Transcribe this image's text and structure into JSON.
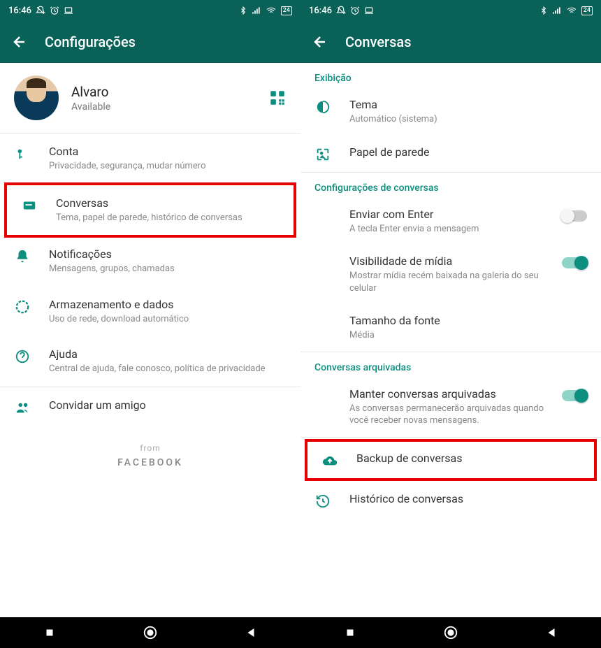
{
  "status": {
    "time": "16:46",
    "battery": "24"
  },
  "left": {
    "header_title": "Configurações",
    "profile": {
      "name": "Alvaro",
      "status": "Available"
    },
    "items": {
      "account": {
        "title": "Conta",
        "sub": "Privacidade, segurança, mudar número"
      },
      "chats": {
        "title": "Conversas",
        "sub": "Tema, papel de parede, histórico de conversas"
      },
      "notifications": {
        "title": "Notificações",
        "sub": "Mensagens, grupos, chamadas"
      },
      "storage": {
        "title": "Armazenamento e dados",
        "sub": "Uso de rede, download automático"
      },
      "help": {
        "title": "Ajuda",
        "sub": "Central de ajuda, fale conosco, política de privacidade"
      },
      "invite": {
        "title": "Convidar um amigo"
      }
    },
    "from_label": "from",
    "from_brand": "FACEBOOK"
  },
  "right": {
    "header_title": "Conversas",
    "sections": {
      "display": "Exibição",
      "chat_settings": "Configurações de conversas",
      "archived": "Conversas arquivadas"
    },
    "items": {
      "theme": {
        "title": "Tema",
        "sub": "Automático (sistema)"
      },
      "wallpaper": {
        "title": "Papel de parede"
      },
      "enter_send": {
        "title": "Enviar com Enter",
        "sub": "A tecla Enter envia a mensagem"
      },
      "media_visibility": {
        "title": "Visibilidade de mídia",
        "sub": "Mostrar mídia recém baixada na galeria do seu celular"
      },
      "font_size": {
        "title": "Tamanho da fonte",
        "sub": "Média"
      },
      "keep_archived": {
        "title": "Manter conversas arquivadas",
        "sub": "As conversas permanecerão arquivadas quando você receber novas mensagens."
      },
      "backup": {
        "title": "Backup de conversas"
      },
      "history": {
        "title": "Histórico de conversas"
      }
    }
  }
}
